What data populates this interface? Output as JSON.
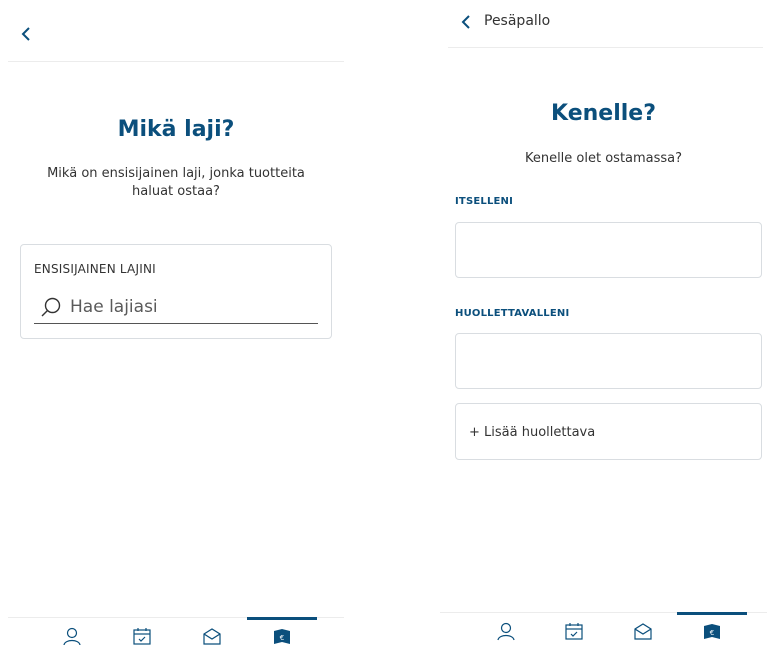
{
  "screen_left": {
    "title": "Mikä laji?",
    "subtitle": "Mikä on ensisijainen laji, jonka tuotteita haluat ostaa?",
    "sport_field": {
      "label": "ENSISIJAINEN LAJINI",
      "placeholder": "Hae lajiasi",
      "value": ""
    }
  },
  "screen_right": {
    "header_title": "Pesäpallo",
    "title": "Kenelle?",
    "subtitle": "Kenelle olet ostamassa?",
    "self_label": "ITSELLENI",
    "dependent_label": "HUOLLETTAVALLENI",
    "add_dependent_label": "+ Lisää huollettava"
  },
  "tabbar": {
    "items": [
      {
        "icon": "user-icon"
      },
      {
        "icon": "calendar-icon"
      },
      {
        "icon": "mail-icon"
      },
      {
        "icon": "wallet-icon",
        "active": true
      }
    ]
  },
  "colors": {
    "accent": "#0b4f7c",
    "border": "#d9dde1"
  }
}
